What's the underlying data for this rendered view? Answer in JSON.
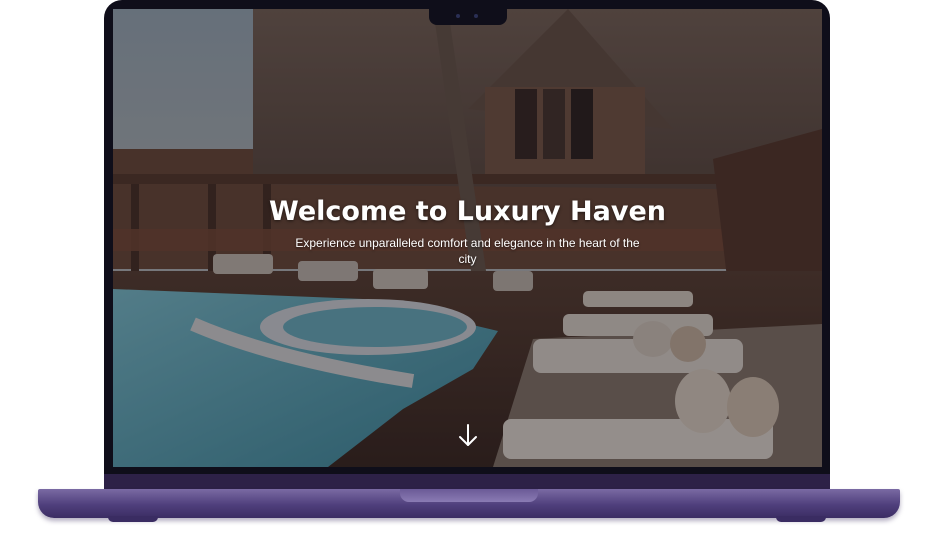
{
  "hero": {
    "title": "Welcome to Luxury Haven",
    "subtitle": "Experience unparalleled comfort and elegance in the heart of the city"
  },
  "icons": {
    "scroll_down": "arrow-down-icon",
    "camera": "camera-dot-icon"
  },
  "colors": {
    "laptop_body": "#4f3f7c",
    "bezel": "#0f0e1a",
    "hero_text": "#ffffff"
  }
}
